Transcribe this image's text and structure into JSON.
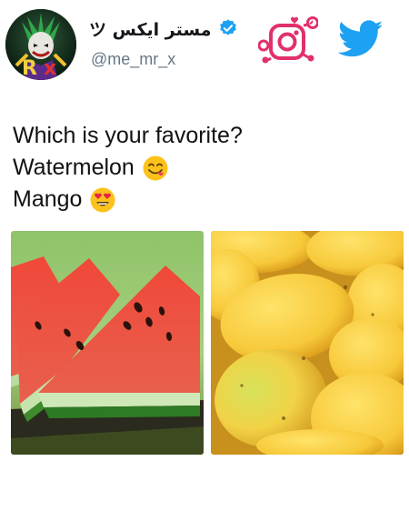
{
  "profile": {
    "display_name": "مستر ایکس ツ",
    "handle": "@me_mr_x",
    "avatar_icon": "joker-avatar",
    "verified_icon": "verified-badge-icon",
    "avatar_letters": "Rx"
  },
  "social_icons": {
    "instagram": "instagram-icon",
    "twitter": "twitter-bird-icon"
  },
  "tweet": {
    "lines": [
      {
        "text": "Which is your favorite?",
        "emoji": ""
      },
      {
        "text": "Watermelon",
        "emoji": "yum-face"
      },
      {
        "text": "Mango",
        "emoji": "heart-eyes-face"
      }
    ]
  },
  "media": {
    "images": [
      {
        "subject": "watermelon-slices"
      },
      {
        "subject": "mangoes"
      }
    ]
  },
  "colors": {
    "verified": "#1da1f2",
    "twitter": "#1da1f2",
    "instagram_ring": "#e1306c",
    "handle": "#657786"
  }
}
